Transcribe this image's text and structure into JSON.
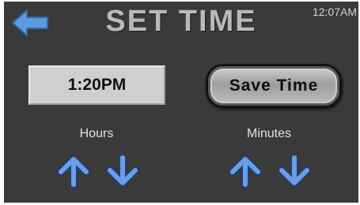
{
  "header": {
    "title": "SET TIME",
    "clock": "12:07AM",
    "back_icon": "back-arrow-icon"
  },
  "time_display": {
    "value": "1:20PM"
  },
  "save_button": {
    "label": "Save Time"
  },
  "hours": {
    "label": "Hours",
    "up_icon": "arrow-up-icon",
    "down_icon": "arrow-down-icon"
  },
  "minutes": {
    "label": "Minutes",
    "up_icon": "arrow-up-icon",
    "down_icon": "arrow-down-icon"
  },
  "colors": {
    "background": "#3a3a3a",
    "accent_blue": "#5b8fd6",
    "title_gray": "#b9b9b9"
  }
}
